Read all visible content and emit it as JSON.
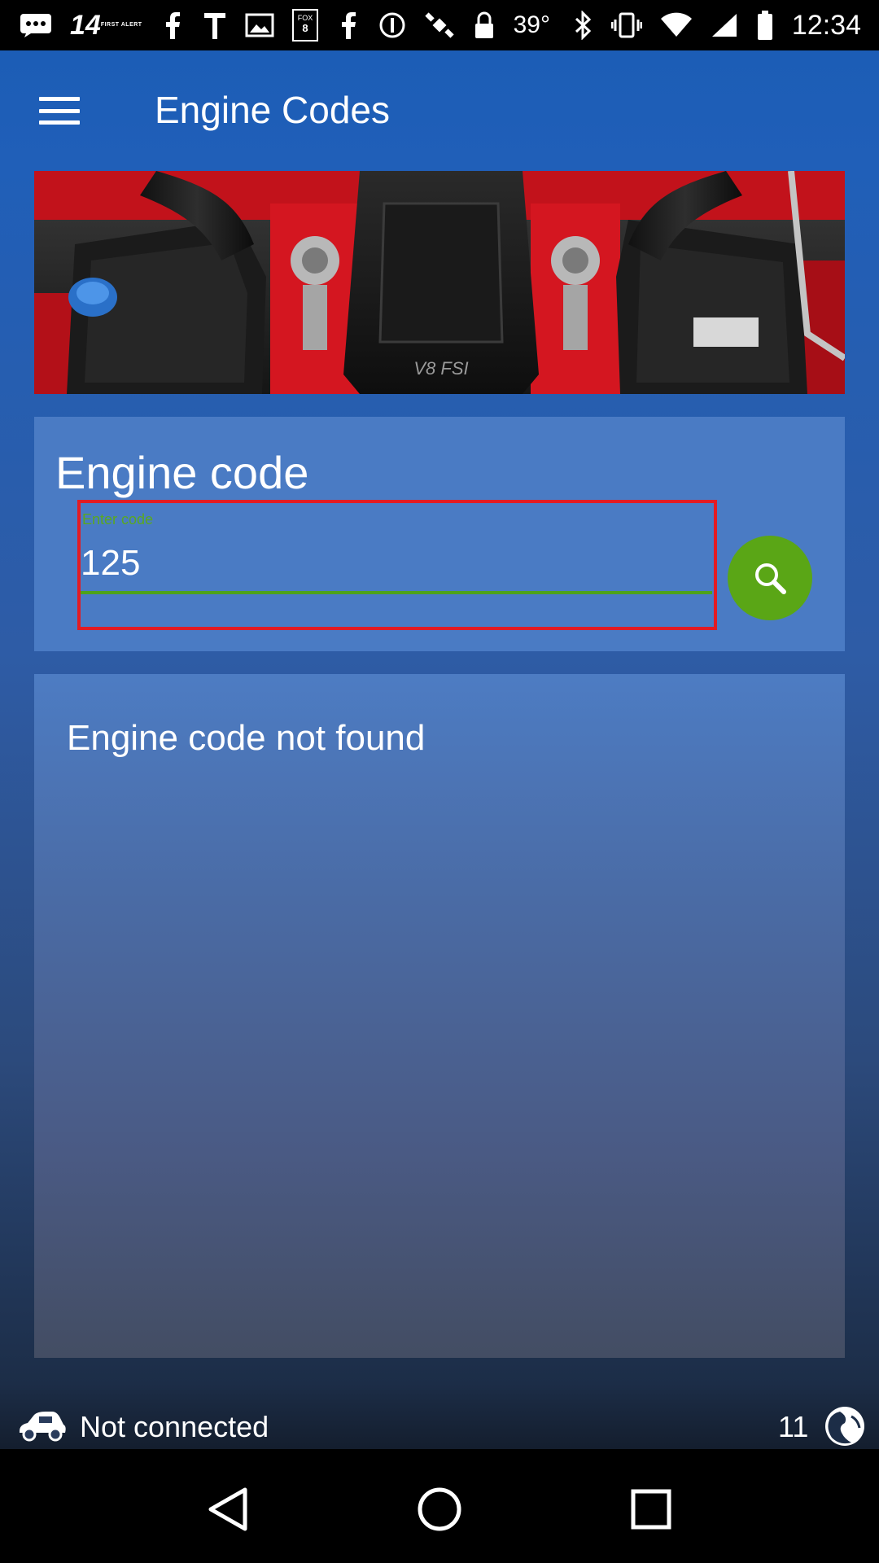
{
  "status_bar": {
    "channel_number": "14",
    "channel_subtext": "FIRST ALERT",
    "temperature": "39°",
    "time": "12:34",
    "icons": [
      "fox8-icon",
      "facebook-icon",
      "news-icon",
      "tv-icon",
      "image-icon",
      "facebook-icon",
      "circle-icon",
      "satellite-icon",
      "lock-icon",
      "bluetooth-icon",
      "vibrate-icon",
      "wifi-icon",
      "signal-icon",
      "battery-icon"
    ]
  },
  "app_bar": {
    "title": "Engine Codes",
    "menu_icon": "hamburger-menu-icon"
  },
  "search_card": {
    "title": "Engine code",
    "input_label": "Enter code",
    "input_value": "125",
    "search_icon": "search-icon"
  },
  "result_card": {
    "message": "Engine code not found"
  },
  "connection": {
    "status": "Not connected",
    "count": "11",
    "car_icon": "car-icon",
    "globe_icon": "globe-icon"
  },
  "nav_bar": {
    "buttons": [
      "back-icon",
      "home-icon",
      "recents-icon"
    ]
  },
  "colors": {
    "background_top": "#1a5cb5",
    "card_blue": "#4a7bc4",
    "accent_green": "#5aa616",
    "highlight_red": "#e21b23"
  }
}
